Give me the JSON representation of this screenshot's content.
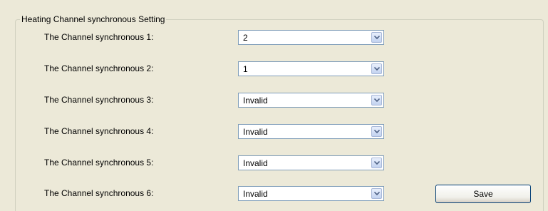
{
  "group": {
    "title": "Heating Channel synchronous Setting"
  },
  "rows": [
    {
      "label": "The Channel synchronous 1:",
      "value": "2"
    },
    {
      "label": "The Channel synchronous 2:",
      "value": "1"
    },
    {
      "label": "The Channel synchronous 3:",
      "value": "Invalid"
    },
    {
      "label": "The Channel synchronous 4:",
      "value": "Invalid"
    },
    {
      "label": "The Channel synchronous 5:",
      "value": "Invalid"
    },
    {
      "label": "The Channel synchronous 6:",
      "value": "Invalid"
    }
  ],
  "actions": {
    "save_label": "Save"
  },
  "icons": {
    "dropdown": "chevron-down-icon"
  },
  "colors": {
    "background": "#ece9d8",
    "combo_border": "#7f9db9",
    "button_border": "#003c74",
    "arrow": "#4d6185"
  }
}
